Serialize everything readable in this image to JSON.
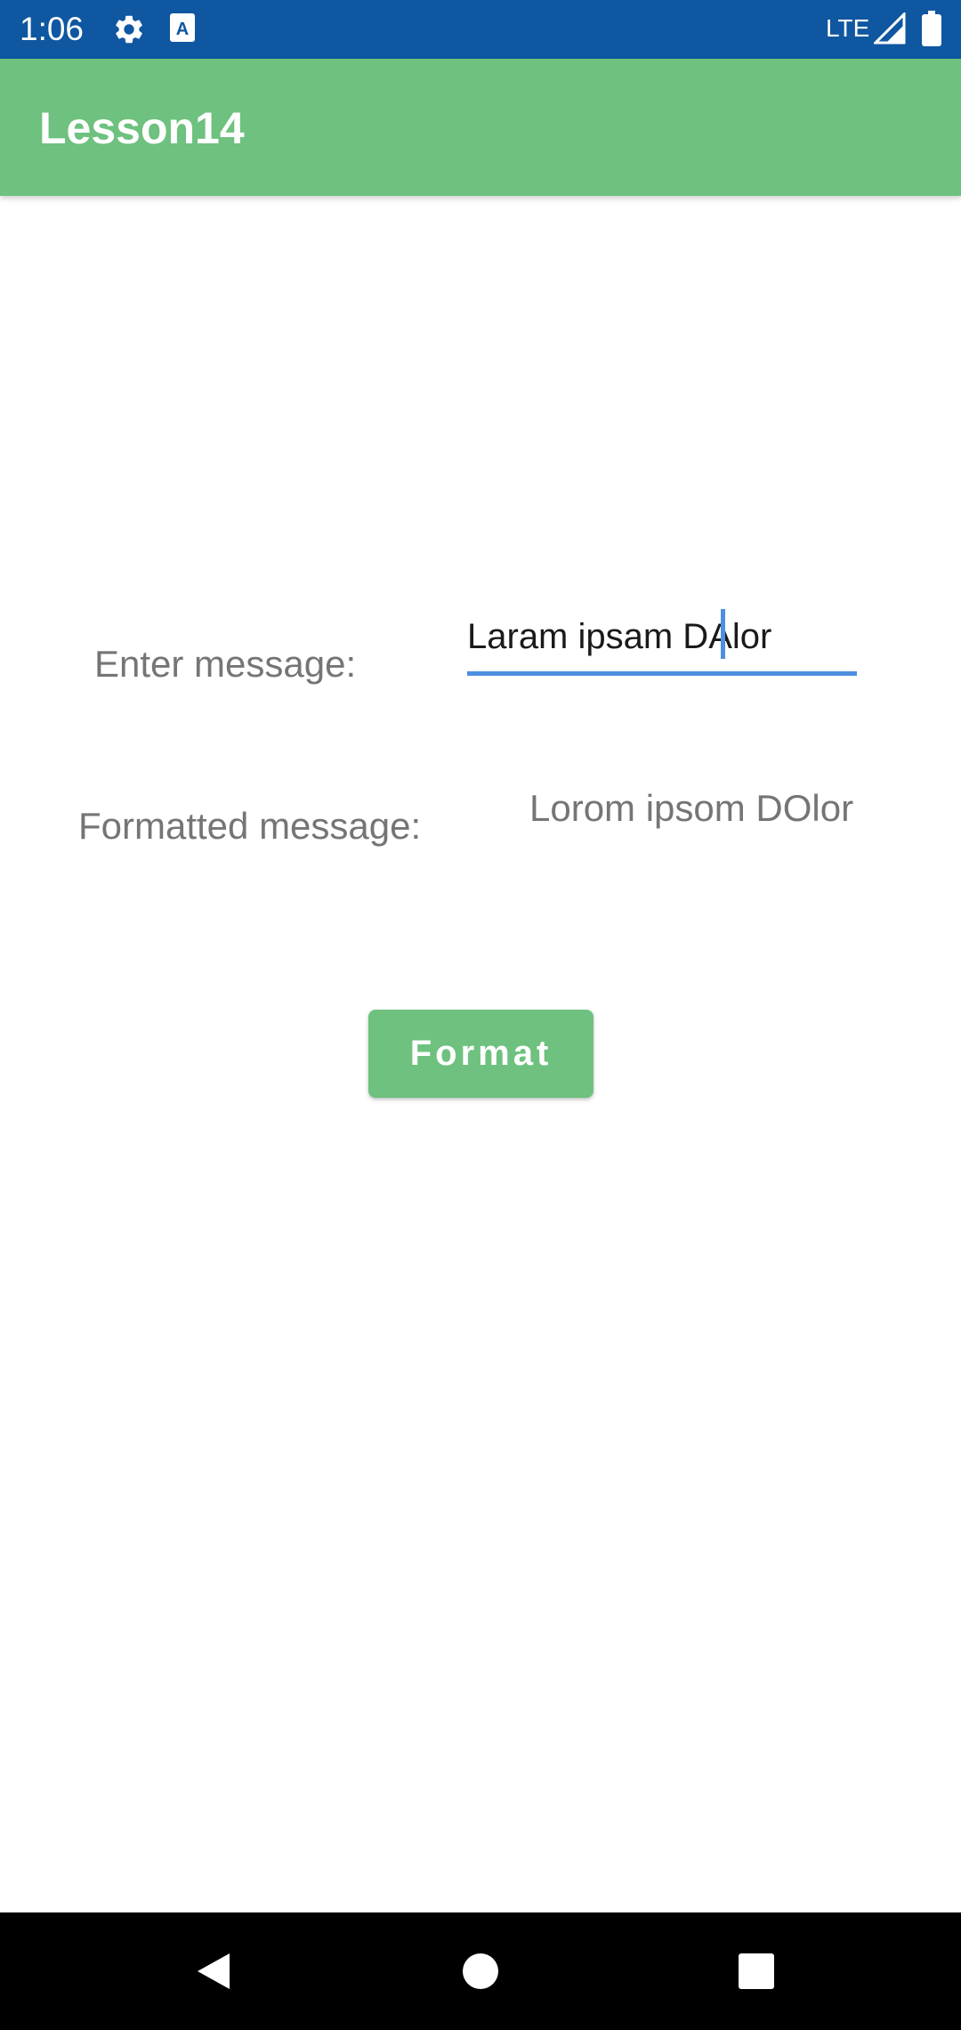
{
  "status_bar": {
    "time": "1:06",
    "network": "LTE",
    "icons": [
      "gear-icon",
      "text-a-icon",
      "signal-icon",
      "battery-icon"
    ]
  },
  "app_bar": {
    "title": "Lesson14"
  },
  "form": {
    "enter_label": "Enter message:",
    "input_value": "Laram ipsam DAlor",
    "formatted_label": "Formatted message:",
    "formatted_value": "Lorom ipsom DOlor",
    "format_button_label": "Format"
  },
  "nav_bar": {
    "icons": [
      "back-icon",
      "home-icon",
      "recents-icon"
    ]
  },
  "colors": {
    "status_bar": "#0f57a0",
    "app_bar": "#6ec17e",
    "accent": "#4d8fe0",
    "label_text": "#757575"
  }
}
